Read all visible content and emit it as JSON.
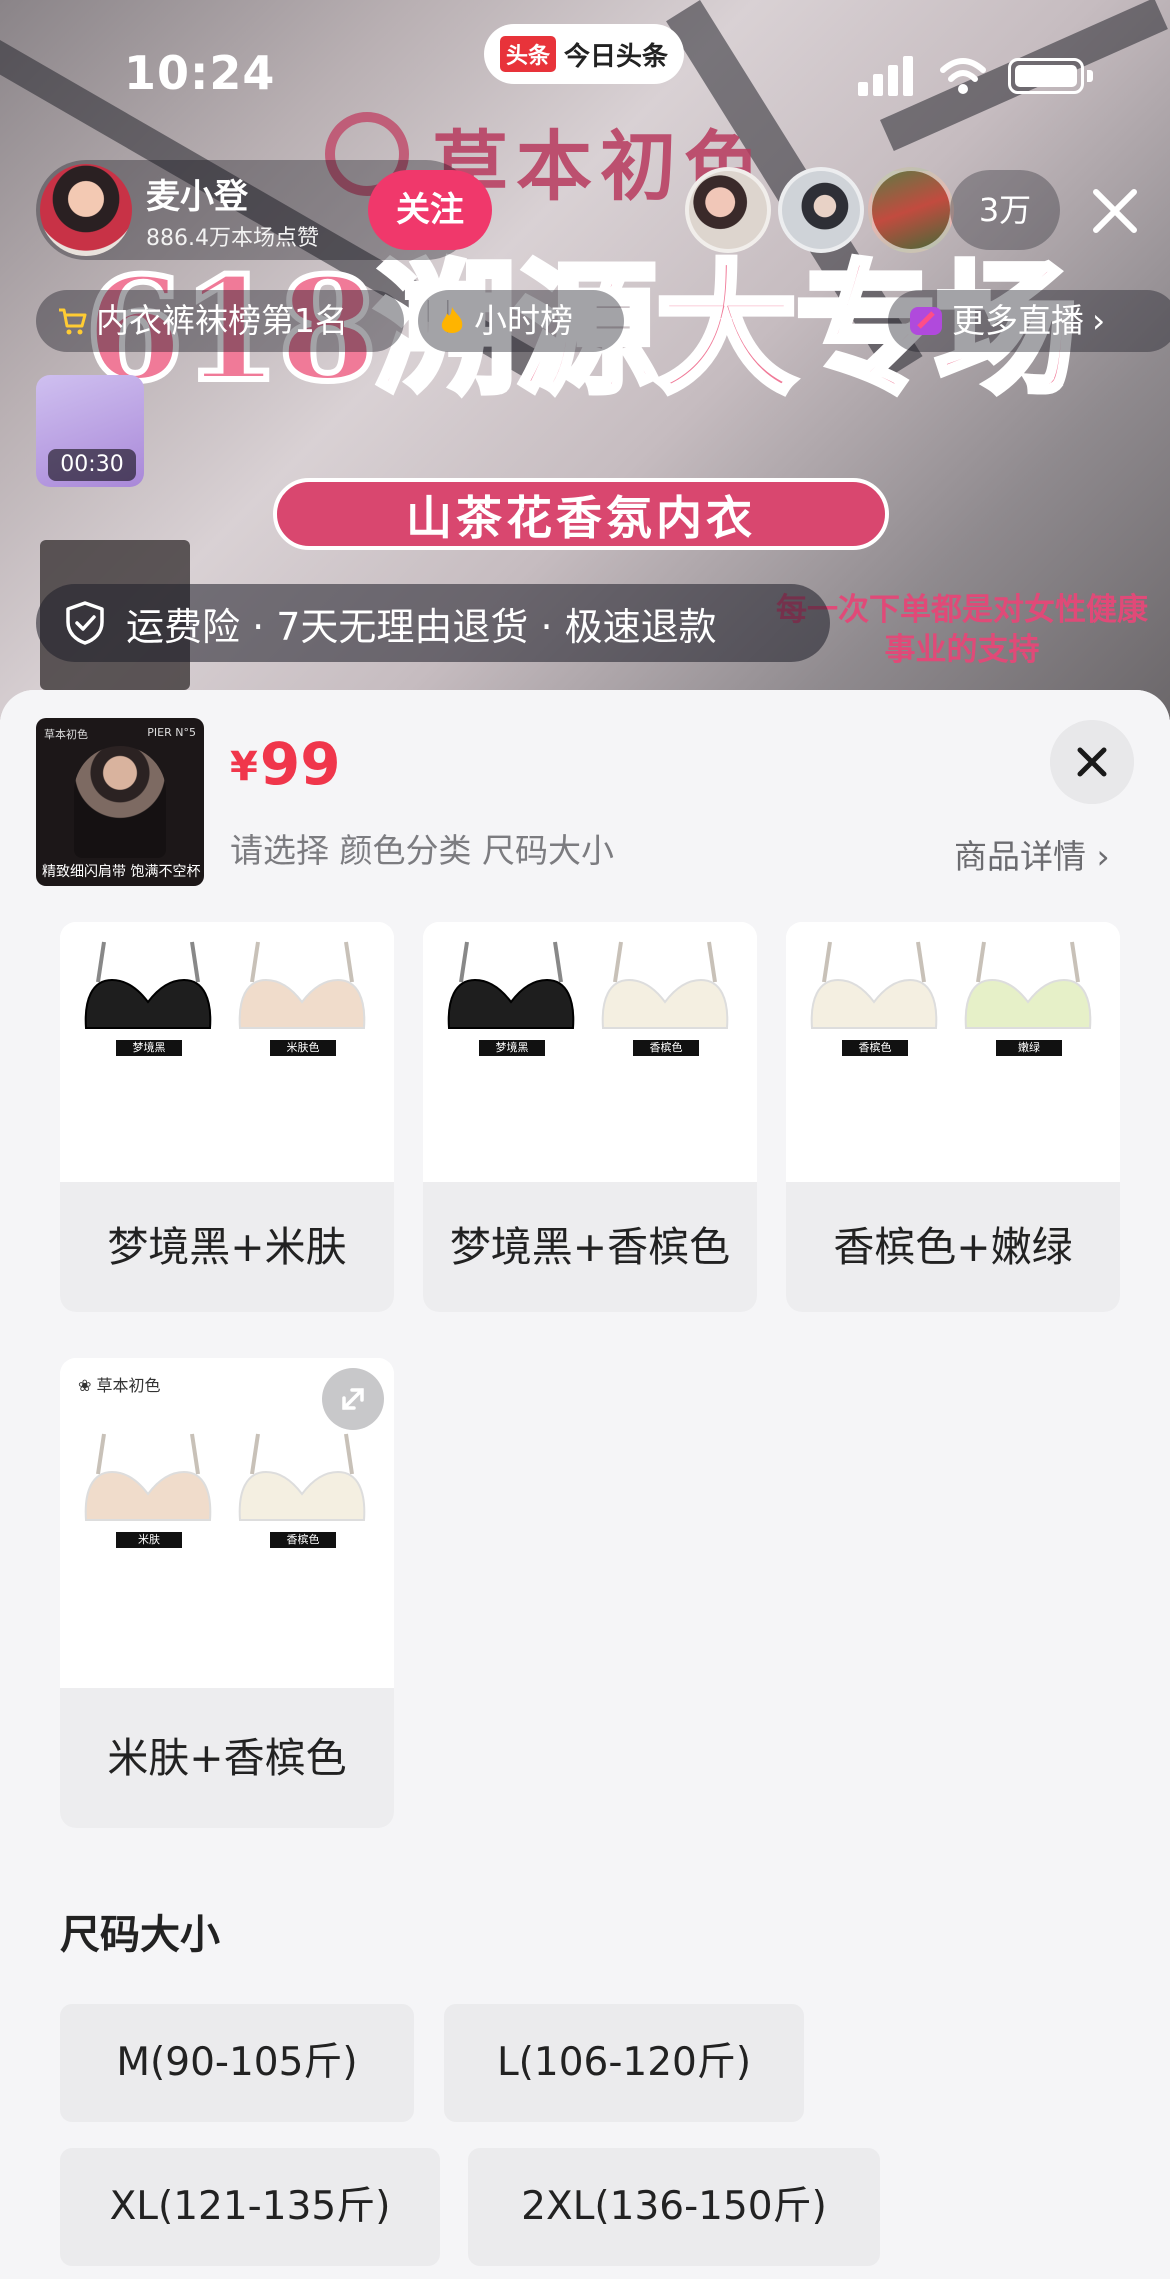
{
  "status_bar": {
    "time": "10:24",
    "app_badge_mark": "头条",
    "app_badge_name": "今日头条"
  },
  "stream": {
    "brand_banner": "草本初色",
    "headline_banner": "618溯源大专场",
    "sub_banner": "山茶花香氛内衣",
    "side_note": "每一次下单都是对女性健康事业的支持"
  },
  "host": {
    "name": "麦小登",
    "likes": "886.4万本场点赞",
    "follow_label": "关注"
  },
  "viewers": {
    "count": "3万"
  },
  "ranking": {
    "rank_label": "内衣裤袜榜第1名",
    "hour_label": "小时榜",
    "more_label": "更多直播"
  },
  "mini_card": {
    "time": "00:30"
  },
  "assurance": {
    "text": "运费险 · 7天无理由退货 · 极速退款"
  },
  "product": {
    "thumb_brand": "草本初色",
    "thumb_tag": "PIER N°5",
    "thumb_caption": "精致细闪肩带 饱满不空杯",
    "price_symbol": "¥",
    "price": "99",
    "select_hint": "请选择 颜色分类 尺码大小",
    "detail_label": "商品详情"
  },
  "color_options": [
    {
      "label": "梦境黑+米肤",
      "left_tag": "梦境黑",
      "right_tag": "米肤色",
      "left_color": "#1e1e1e",
      "right_color": "#f0dccb"
    },
    {
      "label": "梦境黑+香槟色",
      "left_tag": "梦境黑",
      "right_tag": "香槟色",
      "left_color": "#1e1e1e",
      "right_color": "#f4efe1"
    },
    {
      "label": "香槟色+嫩绿",
      "left_tag": "香槟色",
      "right_tag": "嫩绿",
      "left_color": "#f4efe1",
      "right_color": "#e6f0c8"
    },
    {
      "label": "米肤+香槟色",
      "left_tag": "米肤",
      "right_tag": "香槟色",
      "left_color": "#f0dccb",
      "right_color": "#f4efe1",
      "brand": "草本初色"
    }
  ],
  "sizes": {
    "title": "尺码大小",
    "options": [
      "M(90-105斤)",
      "L(106-120斤)",
      "XL(121-135斤)",
      "2XL(136-150斤)"
    ]
  },
  "colors": {
    "accent": "#f0386b",
    "price": "#f0364b",
    "sheet_bg": "#f5f5f7"
  }
}
